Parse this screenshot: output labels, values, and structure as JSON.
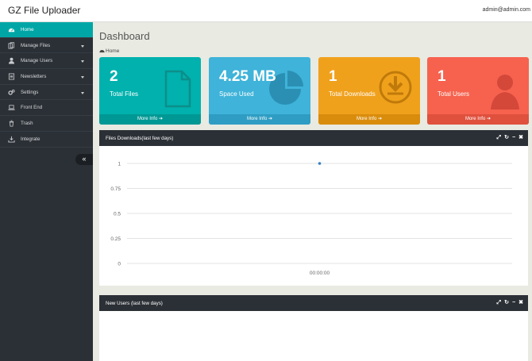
{
  "app": {
    "title": "GZ File Uploader",
    "user": "admin@admin.com"
  },
  "sidebar": {
    "items": [
      {
        "label": "Home",
        "icon": "dashboard-icon",
        "active": true,
        "has_submenu": false
      },
      {
        "label": "Manage Files",
        "icon": "files-icon",
        "active": false,
        "has_submenu": true
      },
      {
        "label": "Manage Users",
        "icon": "user-icon",
        "active": false,
        "has_submenu": true
      },
      {
        "label": "Newsletters",
        "icon": "newsletter-icon",
        "active": false,
        "has_submenu": true
      },
      {
        "label": "Settings",
        "icon": "cogs-icon",
        "active": false,
        "has_submenu": true
      },
      {
        "label": "Front End",
        "icon": "laptop-icon",
        "active": false,
        "has_submenu": false
      },
      {
        "label": "Trash",
        "icon": "trash-icon",
        "active": false,
        "has_submenu": false
      },
      {
        "label": "Integrate",
        "icon": "download-icon",
        "active": false,
        "has_submenu": false
      }
    ],
    "collapse_glyph": "«"
  },
  "page": {
    "title": "Dashboard",
    "breadcrumb": "Home"
  },
  "cards": [
    {
      "value": "2",
      "label": "Total Files",
      "more": "More Info",
      "icon": "file-icon",
      "color": "#00b1ad"
    },
    {
      "value": "4.25 MB",
      "label": "Space Used",
      "more": "More Info",
      "icon": "pie-chart-icon",
      "color": "#3fb3d9"
    },
    {
      "value": "1",
      "label": "Total Downloads",
      "more": "More Info",
      "icon": "download-circle-icon",
      "color": "#f0a11c"
    },
    {
      "value": "1",
      "label": "Total Users",
      "more": "More Info",
      "icon": "user-silhouette-icon",
      "color": "#f6624e"
    }
  ],
  "panels": {
    "downloads": {
      "title": "Files Downloads(last few days)"
    },
    "users": {
      "title": "New Users (last few days)"
    }
  },
  "chart_data": {
    "type": "line",
    "title": "",
    "x": [
      "00:00:00"
    ],
    "series": [
      {
        "values": [
          1
        ]
      }
    ],
    "ylim": [
      0,
      1
    ],
    "yticks": [
      "1",
      "0.75",
      "0.5",
      "0.25",
      "0"
    ],
    "grid": true,
    "color": "#3a7fc1"
  }
}
